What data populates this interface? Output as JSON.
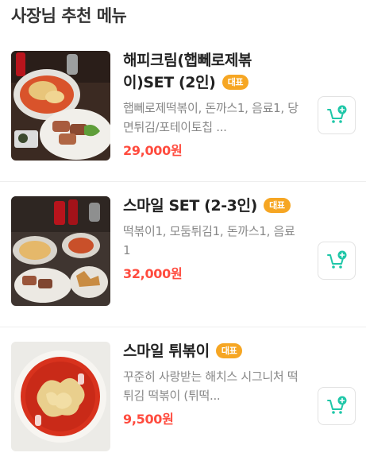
{
  "section": {
    "title": "사장님 추천 메뉴"
  },
  "badge_color": "#f6a623",
  "price_color": "#ff4b3e",
  "cart_icon_color": "#1fc7a8",
  "items": [
    {
      "name": "해피크림(햅뻬로제볶이)SET (2인)",
      "badge": "대표",
      "description": "햅뻬로제떡볶이, 돈까스1, 음료1, 당면튀김/포테이토칩 ...",
      "price": "29,000원",
      "image_icon": "food-photo-rose-tteokbokki-set",
      "cart_icon": "add-to-cart-icon"
    },
    {
      "name": "스마일 SET (2-3인)",
      "badge": "대표",
      "description": "떡볶이1, 모둠튀김1, 돈까스1, 음료1",
      "price": "32,000원",
      "image_icon": "food-photo-smile-set",
      "cart_icon": "add-to-cart-icon"
    },
    {
      "name": "스마일 튀볶이",
      "badge": "대표",
      "description": "꾸준히 사랑받는 해치스 시그니처 떡튀김 떡볶이 (튀떡...",
      "price": "9,500원",
      "image_icon": "food-photo-twibokki",
      "cart_icon": "add-to-cart-icon"
    }
  ]
}
